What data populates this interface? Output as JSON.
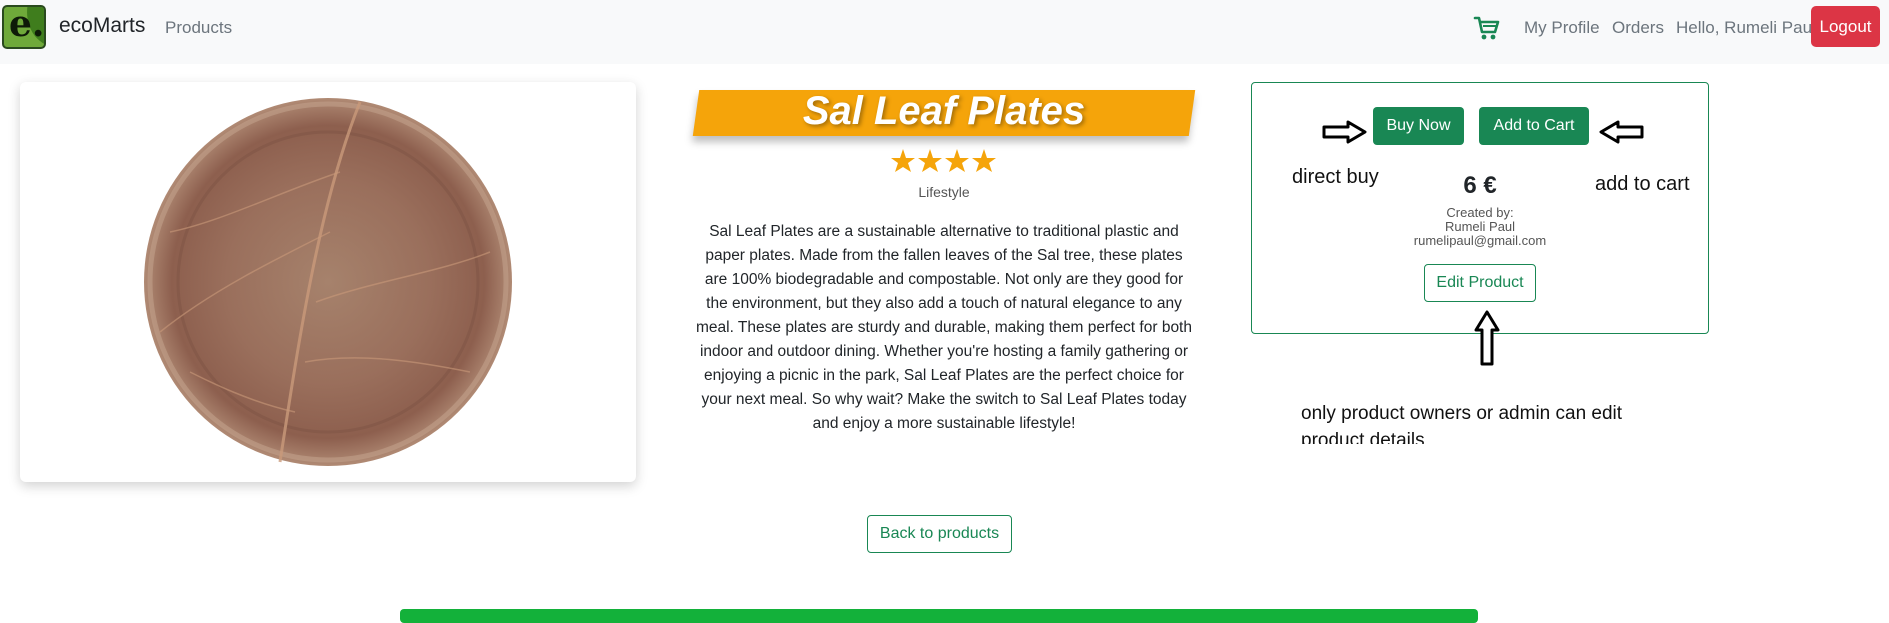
{
  "navbar": {
    "brand": "ecoMarts",
    "products_link": "Products",
    "cart_icon": "shopping-cart-icon",
    "profile_link": "My Profile",
    "orders_link": "Orders",
    "greeting": "Hello, Rumeli Paul",
    "logout_label": "Logout",
    "logout_color": "#dc3545"
  },
  "product": {
    "title": "Sal Leaf Plates",
    "rating": 4,
    "category": "Lifestyle",
    "description": "Sal Leaf Plates are a sustainable alternative to traditional plastic and paper plates. Made from the fallen leaves of the Sal tree, these plates are 100% biodegradable and compostable. Not only are they good for the environment, but they also add a touch of natural elegance to any meal. These plates are sturdy and durable, making them perfect for both indoor and outdoor dining. Whether you're hosting a family gathering or enjoying a picnic in the park, Sal Leaf Plates are the perfect choice for your next meal. So why wait? Make the switch to Sal Leaf Plates today and enjoy a more sustainable lifestyle!",
    "banner_color": "#f5a40a"
  },
  "purchase": {
    "buy_now_label": "Buy Now",
    "add_to_cart_label": "Add to Cart",
    "price": "6 €",
    "created_by_label": "Created by:",
    "creator_name": "Rumeli Paul",
    "creator_email": "rumelipaul@gmail.com",
    "edit_label": "Edit Product",
    "accent_color": "#198754"
  },
  "annotations": {
    "direct_buy": "direct buy",
    "add_to_cart": "add to cart",
    "owners_note": "only product owners or admin can edit product details"
  },
  "back_label": "Back to products"
}
